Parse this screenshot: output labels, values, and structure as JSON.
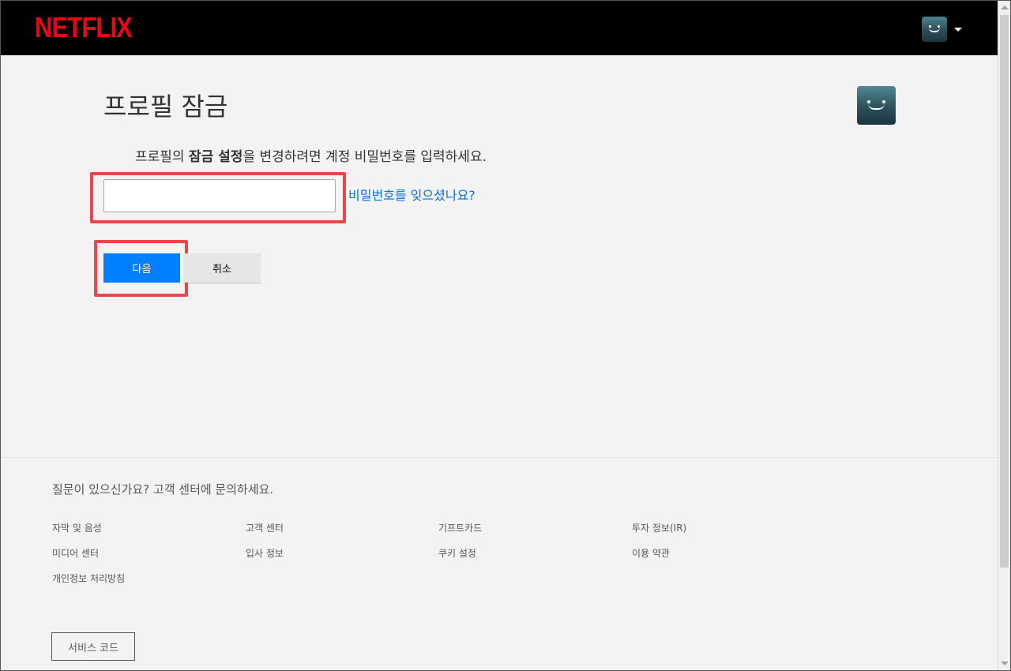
{
  "header": {
    "logo_text": "NETFLIX",
    "logo_color": "#e50914"
  },
  "main": {
    "title": "프로필 잠금",
    "instruction_before": "프로필의 ",
    "instruction_bold": "잠금 설정",
    "instruction_after": "을 변경하려면 계정 비밀번호를 입력하세요.",
    "password_value": "",
    "forgot_link": "비밀번호를 잊으셨나요?",
    "next_button": "다음",
    "cancel_button": "취소",
    "next_color": "#0080ff",
    "link_color": "#0071eb",
    "highlight_color": "#e8484c"
  },
  "footer": {
    "question": "질문이 있으신가요? 고객 센터에 문의하세요.",
    "links": [
      "자막 및 음성",
      "고객 센터",
      "기프트카드",
      "투자 정보(IR)",
      "미디어 센터",
      "입사 정보",
      "쿠키 설정",
      "이용 약관",
      "개인정보 처리방침"
    ],
    "service_code_button": "서비스 코드"
  }
}
